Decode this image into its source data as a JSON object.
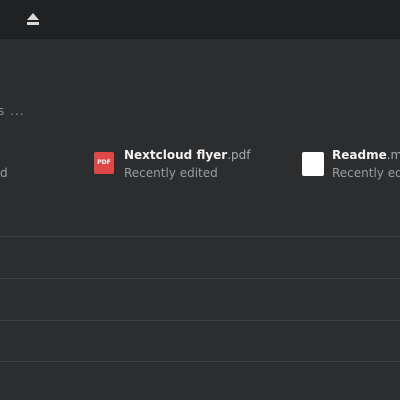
{
  "header": {
    "eject_icon": "eject-icon"
  },
  "search": {
    "hint_text": "s ..."
  },
  "recent": {
    "left_partial_text": "d",
    "files": [
      {
        "base": "Nextcloud flyer",
        "ext": ".pdf",
        "status": "Recently edited",
        "icon": "pdf-file-icon",
        "icon_label": "PDF",
        "icon_color": "#e04848"
      },
      {
        "base": "Readme",
        "ext": ".md",
        "status": "Recently edite",
        "icon": "text-file-icon",
        "icon_color": "#ffffff"
      }
    ]
  },
  "colors": {
    "background": "#2b2d2f",
    "topbar": "#1f2123",
    "divider": "#3c3f42"
  }
}
